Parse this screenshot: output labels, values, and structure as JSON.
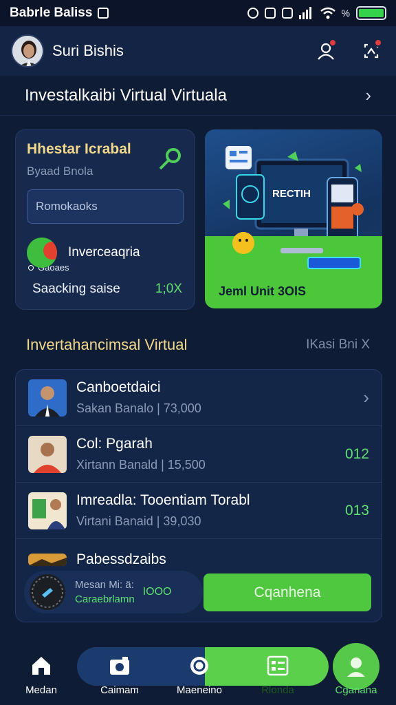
{
  "status_bar": {
    "carrier": "Babrle Baliss"
  },
  "header": {
    "username": "Suri Bishis",
    "avatar": "avatar",
    "icons": [
      "person-icon",
      "network-icon"
    ]
  },
  "section_top": {
    "title": "Investalkaibi Virtual Virtuala"
  },
  "left_card": {
    "title": "Hhestar Icrabal",
    "subtitle": "Byaad Bnola",
    "input_placeholder": "Romokaoks",
    "item_label": "Inverceaqria",
    "item_small": "Gaoaes",
    "bottom_label": "Saacking saise",
    "bottom_value": "1;0X"
  },
  "right_card": {
    "caption": "Jeml Unit 3OIS",
    "screen_title": "RECTIH"
  },
  "section_list": {
    "title": "Invertahancimsal Virtual",
    "right_label": "IKasi Bni X"
  },
  "list": [
    {
      "title": "Canboetdaici",
      "subtitle": "Sakan Banalo | 73,000",
      "value": "›",
      "thumb": "portrait-suit"
    },
    {
      "title": "Col: Pgarah",
      "subtitle": "Xirtann Banald | 15,500",
      "value": "012",
      "thumb": "portrait-red"
    },
    {
      "title": "Imreadla: Tooentiam Torabl",
      "subtitle": "Virtani Banaid | 39,030",
      "value": "013",
      "thumb": "portrait-board"
    },
    {
      "title": "Pabessdzaibs",
      "subtitle": "",
      "value": "",
      "thumb": "landscape"
    }
  ],
  "pill": {
    "line1": "Mesan Mi: ä:",
    "line2": "Caraebrlamn",
    "value": "IOOO"
  },
  "cta": {
    "label": "Cqanhena"
  },
  "bottom_nav": [
    {
      "label": "Medan",
      "icon": "home-icon"
    },
    {
      "label": "Caimam",
      "icon": "camera-icon"
    },
    {
      "label": "Maeneino",
      "icon": "target-icon"
    },
    {
      "label": "Rlonda",
      "icon": "list-icon"
    },
    {
      "label": "Cganana",
      "icon": "profile-icon"
    }
  ],
  "colors": {
    "background": "#0f1c36",
    "card": "#172a4e",
    "accent_green": "#4fc83f",
    "accent_yellow": "#f2d88a",
    "text_muted": "#8a99b4"
  }
}
